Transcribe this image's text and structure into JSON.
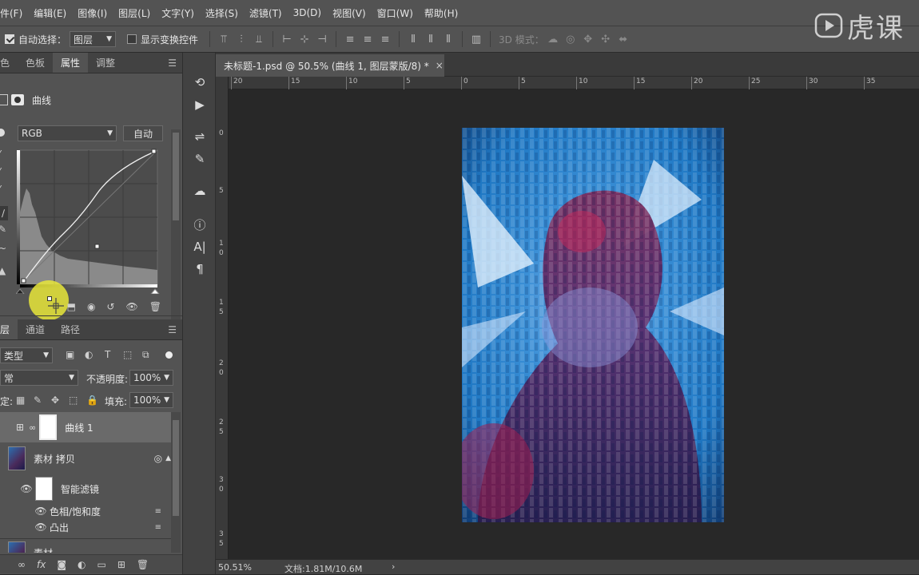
{
  "menubar": {
    "items": [
      "件(F)",
      "编辑(E)",
      "图像(I)",
      "图层(L)",
      "文字(Y)",
      "选择(S)",
      "滤镜(T)",
      "3D(D)",
      "视图(V)",
      "窗口(W)",
      "帮助(H)"
    ],
    "logo_text": "虎课"
  },
  "options": {
    "auto_select_label": "自动选择：",
    "auto_select_value": "图层",
    "show_transform_label": "显示变换控件",
    "mode_3d_label": "3D 模式："
  },
  "properties_panel": {
    "tabs": [
      "色",
      "色板",
      "属性",
      "调整"
    ],
    "active_tab": "属性",
    "title": "曲线",
    "channel": "RGB",
    "auto_label": "自动"
  },
  "layers_panel": {
    "tabs": [
      "层",
      "通道",
      "路径"
    ],
    "active_tab": "层",
    "filter_kind": "类型",
    "blend_mode": "常",
    "opacity_label": "不透明度:",
    "opacity_value": "100%",
    "lock_label": "定:",
    "fill_label": "填充:",
    "fill_value": "100%",
    "layers": [
      {
        "name": "曲线 1"
      },
      {
        "name": "素材 拷贝"
      },
      {
        "name": "智能滤镜"
      },
      {
        "name": "色相/饱和度"
      },
      {
        "name": "凸出"
      },
      {
        "name": "素材"
      }
    ]
  },
  "document": {
    "tab_title": "未标题-1.psd @ 50.5% (曲线 1, 图层蒙版/8) *",
    "close_glyph": "×",
    "ruler_h_labels": [
      "20",
      "15",
      "10",
      "5",
      "0",
      "5",
      "10",
      "15",
      "20",
      "25",
      "30",
      "35"
    ],
    "ruler_v_labels": [
      "0",
      "5",
      "1",
      "0",
      "1",
      "5",
      "2",
      "0",
      "2",
      "5",
      "3",
      "0",
      "3",
      "5"
    ],
    "zoom": "50.51%",
    "doc_info": "文档:1.81M/10.6M",
    "status_arrow": "›"
  },
  "colors": {
    "panel": "#535353",
    "dark": "#282828",
    "accent_blue": "#2f8fd8",
    "cursor_highlight": "#e8e63a"
  }
}
